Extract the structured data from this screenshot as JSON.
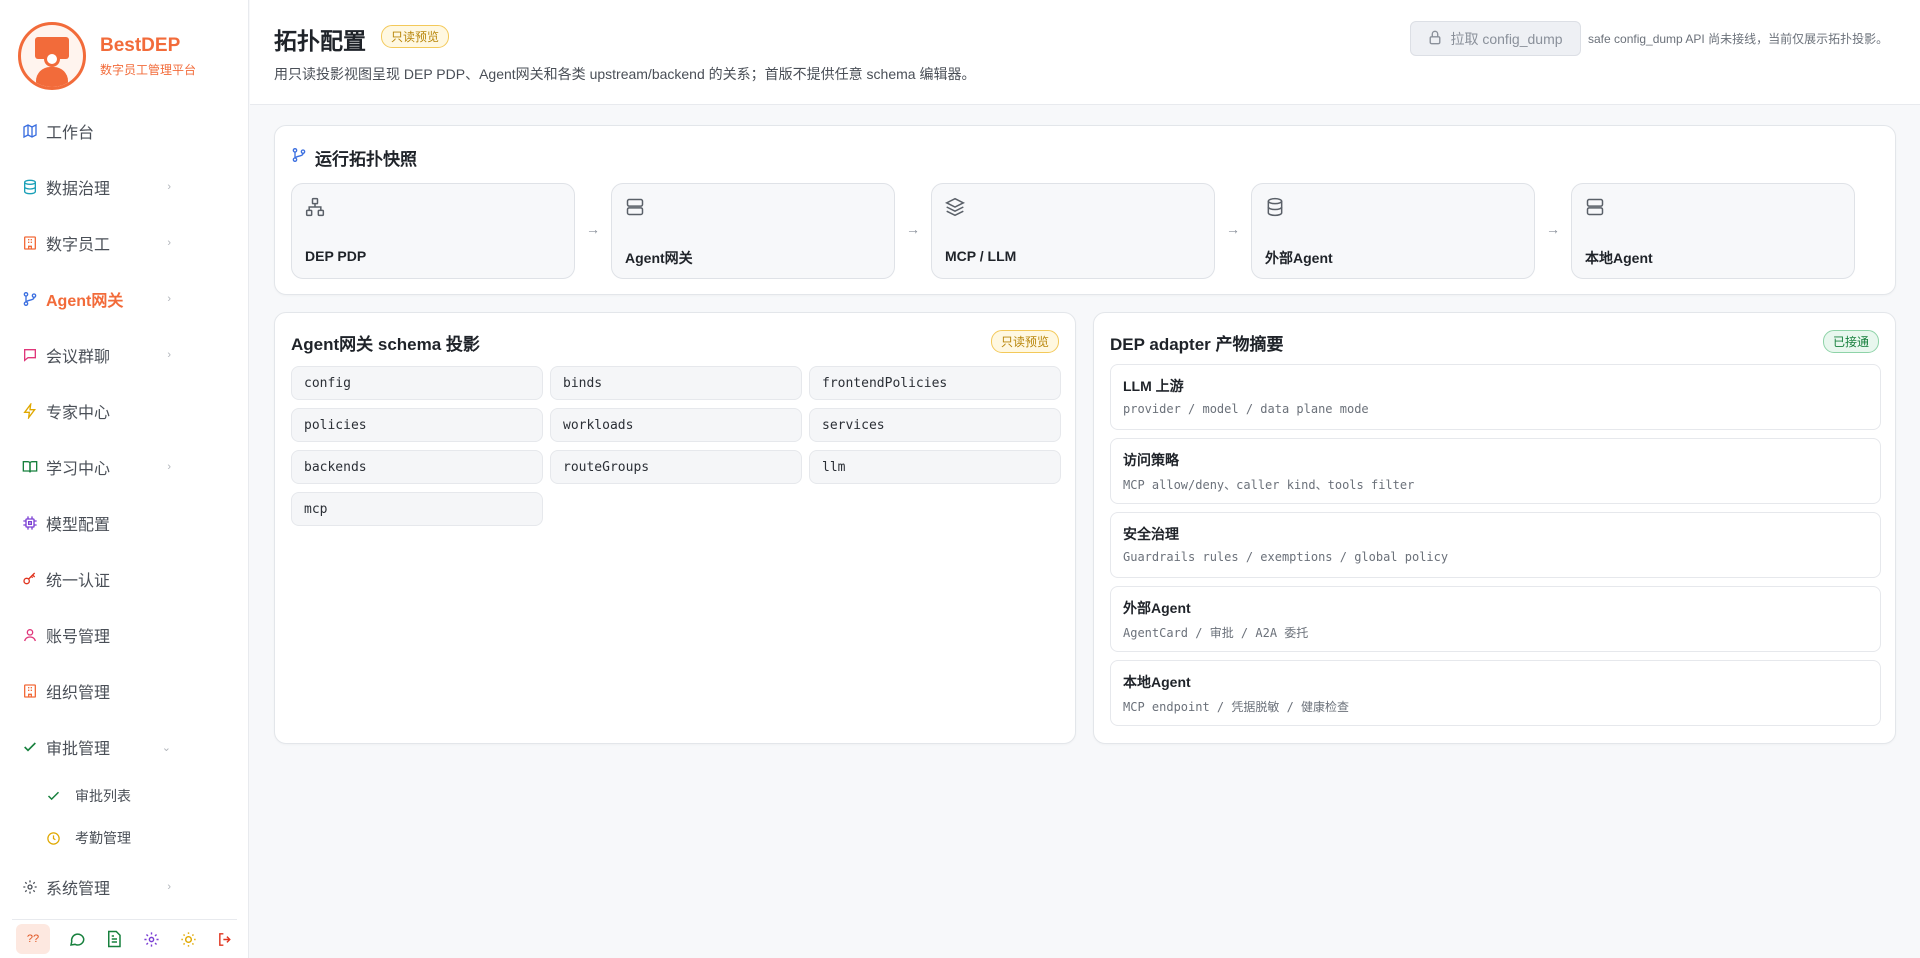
{
  "brand": {
    "name": "BestDEP",
    "subtitle": "数字员工管理平台"
  },
  "colors": {
    "accent": "#f26b3a",
    "success": "#17803d",
    "warning": "#b8860b"
  },
  "nav": [
    {
      "label": "工作台",
      "icon": "map-icon",
      "chevron": false,
      "active": false
    },
    {
      "label": "数据治理",
      "icon": "database-icon",
      "chevron": true,
      "active": false
    },
    {
      "label": "数字员工",
      "icon": "building-icon",
      "chevron": true,
      "active": false
    },
    {
      "label": "Agent网关",
      "icon": "git-branch-icon",
      "chevron": true,
      "active": true
    },
    {
      "label": "会议群聊",
      "icon": "chat-icon",
      "chevron": true,
      "active": false
    },
    {
      "label": "专家中心",
      "icon": "lightning-icon",
      "chevron": false,
      "active": false
    },
    {
      "label": "学习中心",
      "icon": "book-icon",
      "chevron": true,
      "active": false
    },
    {
      "label": "模型配置",
      "icon": "cpu-icon",
      "chevron": false,
      "active": false
    },
    {
      "label": "统一认证",
      "icon": "key-icon",
      "chevron": false,
      "active": false
    },
    {
      "label": "账号管理",
      "icon": "user-icon",
      "chevron": false,
      "active": false
    },
    {
      "label": "组织管理",
      "icon": "building-icon",
      "chevron": false,
      "active": false
    },
    {
      "label": "审批管理",
      "icon": "check-icon",
      "chevron": true,
      "active": false
    }
  ],
  "subnav": [
    {
      "label": "审批列表",
      "icon": "check-icon"
    },
    {
      "label": "考勤管理",
      "icon": "clock-icon"
    }
  ],
  "nav_bottom": {
    "label": "系统管理",
    "icon": "gear-icon"
  },
  "footer_buttons": {
    "help": "??"
  },
  "header": {
    "title": "拓扑配置",
    "badge": "只读预览",
    "description": "用只读投影视图呈现 DEP PDP、Agent网关和各类 upstream/backend 的关系；首版不提供任意 schema 编辑器。",
    "fetch_button": "拉取 config_dump",
    "fetch_note": "safe config_dump API 尚未接线，当前仅展示拓扑投影。"
  },
  "topology": {
    "title": "运行拓扑快照",
    "nodes": [
      {
        "name": "DEP PDP",
        "icon": "network-icon"
      },
      {
        "name": "Agent网关",
        "icon": "server-icon"
      },
      {
        "name": "MCP / LLM",
        "icon": "layers-icon"
      },
      {
        "name": "外部Agent",
        "icon": "database-icon"
      },
      {
        "name": "本地Agent",
        "icon": "server-icon"
      }
    ],
    "arrow": "→"
  },
  "schema": {
    "title": "Agent网关 schema 投影",
    "badge": "只读预览",
    "items": [
      "config",
      "binds",
      "frontendPolicies",
      "policies",
      "workloads",
      "services",
      "backends",
      "routeGroups",
      "llm",
      "mcp"
    ]
  },
  "adapter": {
    "title": "DEP adapter 产物摘要",
    "badge": "已接通",
    "rows": [
      {
        "title": "LLM 上游",
        "desc": "provider / model / data plane mode"
      },
      {
        "title": "访问策略",
        "desc": "MCP allow/deny、caller kind、tools filter"
      },
      {
        "title": "安全治理",
        "desc": "Guardrails rules / exemptions / global policy"
      },
      {
        "title": "外部Agent",
        "desc": "AgentCard / 审批 / A2A 委托"
      },
      {
        "title": "本地Agent",
        "desc": "MCP endpoint / 凭据脱敏 / 健康检查"
      }
    ]
  }
}
